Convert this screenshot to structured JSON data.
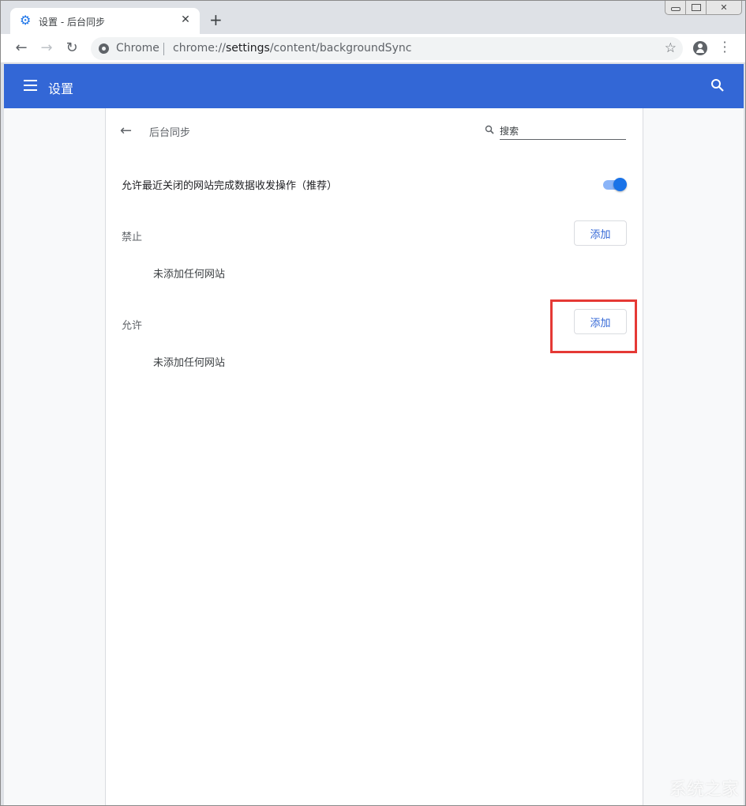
{
  "window": {
    "tab_title": "设置 - 后台同步",
    "tab_favicon": "gear-icon",
    "close_tab_glyph": "✕",
    "new_tab_glyph": "+",
    "controls": [
      "minimize",
      "maximize",
      "close"
    ]
  },
  "toolbar": {
    "back_glyph": "←",
    "forward_glyph": "→",
    "reload_glyph": "↻",
    "origin_label": "Chrome",
    "url_scheme": "chrome://",
    "url_host": "settings",
    "url_path": "/content/backgroundSync",
    "star_glyph": "☆",
    "menu_glyph": "⋮"
  },
  "appbar": {
    "title": "设置",
    "color": "#3367d6"
  },
  "subpage": {
    "back_glyph": "←",
    "title": "后台同步",
    "search_placeholder": "搜索"
  },
  "setting": {
    "label": "允许最近关闭的网站完成数据收发操作（推荐）",
    "enabled": true
  },
  "sections": [
    {
      "label": "禁止",
      "add_label": "添加",
      "empty_text": "未添加任何网站"
    },
    {
      "label": "允许",
      "add_label": "添加",
      "empty_text": "未添加任何网站"
    }
  ],
  "watermark": "系统之家"
}
